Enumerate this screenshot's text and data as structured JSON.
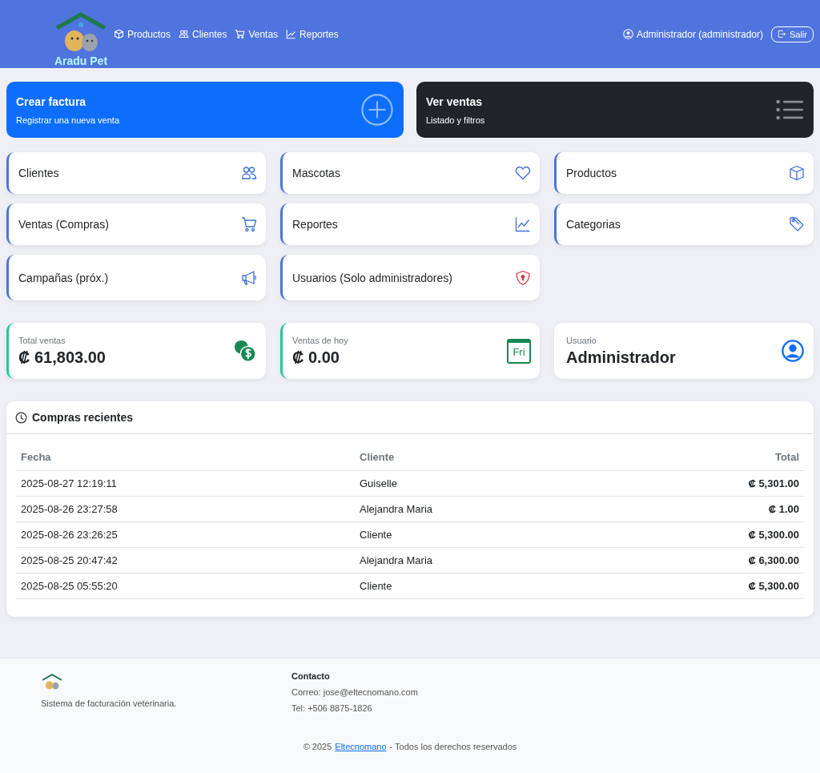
{
  "navbar": {
    "logo_text": "Aradu Pet",
    "links": [
      {
        "label": "Productos"
      },
      {
        "label": "Clientes"
      },
      {
        "label": "Ventas"
      },
      {
        "label": "Reportes"
      }
    ],
    "user": "Administrador (administrador)",
    "logout": "Salir"
  },
  "hero": [
    {
      "title": "Crear factura",
      "subtitle": "Registrar una nueva venta",
      "kind": "primary"
    },
    {
      "title": "Ver ventas",
      "subtitle": "Listado y filtros",
      "kind": "dark"
    }
  ],
  "tiles": [
    {
      "label": "Clientes"
    },
    {
      "label": "Mascotas"
    },
    {
      "label": "Productos"
    },
    {
      "label": "Ventas (Compras)"
    },
    {
      "label": "Reportes"
    },
    {
      "label": "Categorias"
    },
    {
      "label": "Campañas (próx.)"
    },
    {
      "label": "Usuarios (Solo administradores)"
    }
  ],
  "stats": [
    {
      "label": "Total ventas",
      "value": "₡ 61,803.00",
      "accent": true
    },
    {
      "label": "Ventas de hoy",
      "value": "₡ 0.00",
      "accent": true,
      "icon_text": "Fri"
    },
    {
      "label": "Usuario",
      "value": "Administrador",
      "accent": false
    }
  ],
  "recent": {
    "title": "Compras recientes",
    "columns": [
      "Fecha",
      "Cliente",
      "Total"
    ],
    "rows": [
      [
        "2025-08-27 12:19:11",
        "Guiselle",
        "₡ 5,301.00"
      ],
      [
        "2025-08-26 23:27:58",
        "Alejandra Maria",
        "₡ 1.00"
      ],
      [
        "2025-08-26 23:26:25",
        "Cliente",
        "₡ 5,300.00"
      ],
      [
        "2025-08-25 20:47:42",
        "Alejandra Maria",
        "₡ 6,300.00"
      ],
      [
        "2025-08-25 05:55:20",
        "Cliente",
        "₡ 5,300.00"
      ]
    ]
  },
  "footer": {
    "tagline": "Sistema de facturación veterinaria.",
    "contact_title": "Contacto",
    "email": "Correo: jose@eltecnomano.com",
    "phone": "Tel: +506 8875-1826",
    "copyright_before": "© 2025",
    "link": "Eltecnomano",
    "copyright_after": "- Todos los derechos reservados"
  }
}
